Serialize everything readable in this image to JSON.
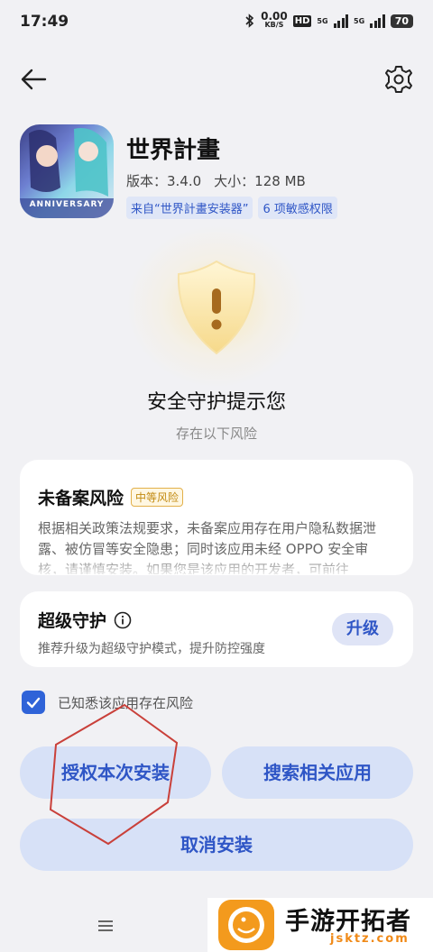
{
  "status_bar": {
    "time": "17:49",
    "net_speed_value": "0.00",
    "net_speed_unit": "KB/S",
    "hd_label": "HD",
    "network_1": "5G",
    "network_2": "5G",
    "battery": "70"
  },
  "nav": {
    "back_icon": "back-arrow-icon",
    "settings_icon": "gear-icon"
  },
  "app": {
    "name": "世界計畫",
    "version_label": "版本：3.4.0",
    "size_label": "大小：128 MB",
    "tags": [
      "来自“世界計畫安装器”",
      "6 项敏感权限"
    ],
    "icon_text": "ANNIVERSARY"
  },
  "guard": {
    "title": "安全守护提示您",
    "subtitle": "存在以下风险"
  },
  "risk_card": {
    "title": "未备案风险",
    "badge": "中等风险",
    "body": "根据相关政策法规要求，未备案应用存在用户隐私数据泄露、被仿冒等安全隐患；同时该应用未经 OPPO 安全审核，请谨慎安装。如果您是该应用的开发者，可前往"
  },
  "super_guard": {
    "title": "超级守护",
    "description": "推荐升级为超级守护模式，提升防控强度",
    "upgrade_label": "升级"
  },
  "acknowledge": {
    "checked": true,
    "label": "已知悉该应用存在风险"
  },
  "buttons": {
    "authorize": "授权本次安装",
    "search_related": "搜索相关应用",
    "cancel": "取消安装"
  },
  "watermark": {
    "name": "手游开拓者",
    "url": "jsktz.com"
  },
  "colors": {
    "accent": "#2f56c6",
    "button_bg": "#d7e1f7",
    "warning": "#c28a10",
    "annotation": "#c9403a"
  }
}
